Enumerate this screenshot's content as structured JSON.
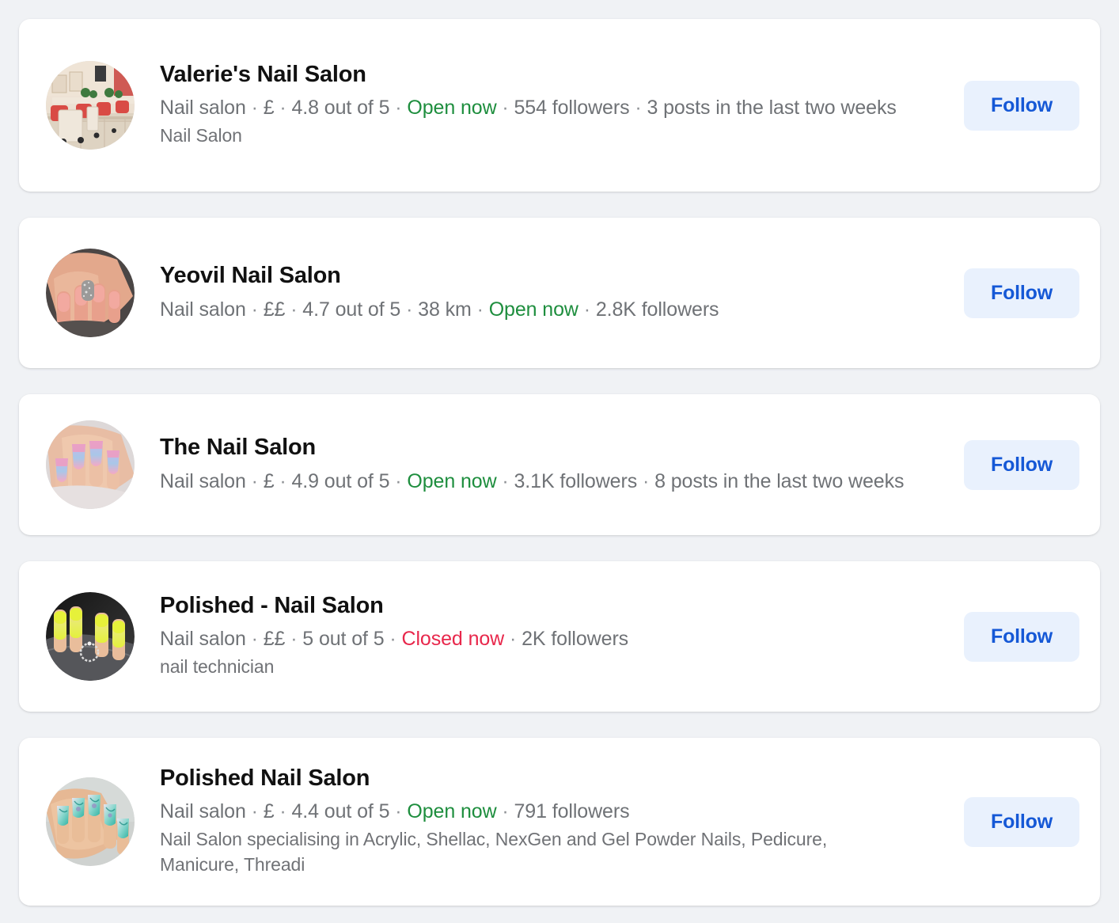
{
  "page": {
    "background_color": "#f0f2f5",
    "card_color": "#ffffff",
    "accent_color": "#1558d6",
    "follow_bg_color": "#e9f1fd",
    "open_color": "#1e8e3e",
    "closed_color": "#e8274b"
  },
  "results": [
    {
      "name": "Valerie's Nail Salon",
      "category": "Nail salon",
      "price": "£",
      "rating": "4.8 out of 5",
      "distance": null,
      "status": "Open now",
      "status_type": "open",
      "followers": "554 followers",
      "posts": "3 posts in the last two weeks",
      "description": "Nail Salon",
      "follow_label": "Follow",
      "avatar": "salon-interior-photo"
    },
    {
      "name": "Yeovil Nail Salon",
      "category": "Nail salon",
      "price": "££",
      "rating": "4.7 out of 5",
      "distance": "38 km",
      "status": "Open now",
      "status_type": "open",
      "followers": "2.8K followers",
      "posts": null,
      "description": null,
      "follow_label": "Follow",
      "avatar": "pink-glitter-nails-photo"
    },
    {
      "name": "The Nail Salon",
      "category": "Nail salon",
      "price": "£",
      "rating": "4.9 out of 5",
      "distance": null,
      "status": "Open now",
      "status_type": "open",
      "followers": "3.1K followers",
      "posts": "8 posts in the last two weeks",
      "description": null,
      "follow_label": "Follow",
      "avatar": "pastel-ombre-nails-photo"
    },
    {
      "name": "Polished - Nail Salon",
      "category": "Nail salon",
      "price": "££",
      "rating": "5 out of 5",
      "distance": null,
      "status": "Closed now",
      "status_type": "closed",
      "followers": "2K followers",
      "posts": null,
      "description": "nail technician",
      "follow_label": "Follow",
      "avatar": "neon-yellow-nails-photo"
    },
    {
      "name": "Polished Nail Salon",
      "category": "Nail salon",
      "price": "£",
      "rating": "4.4 out of 5",
      "distance": null,
      "status": "Open now",
      "status_type": "open",
      "followers": "791 followers",
      "posts": null,
      "description": "Nail Salon specialising in Acrylic, Shellac, NexGen and Gel Powder Nails, Pedicure, Manicure, Threadi",
      "follow_label": "Follow",
      "avatar": "teal-marble-nails-photo"
    }
  ],
  "separator": "·"
}
